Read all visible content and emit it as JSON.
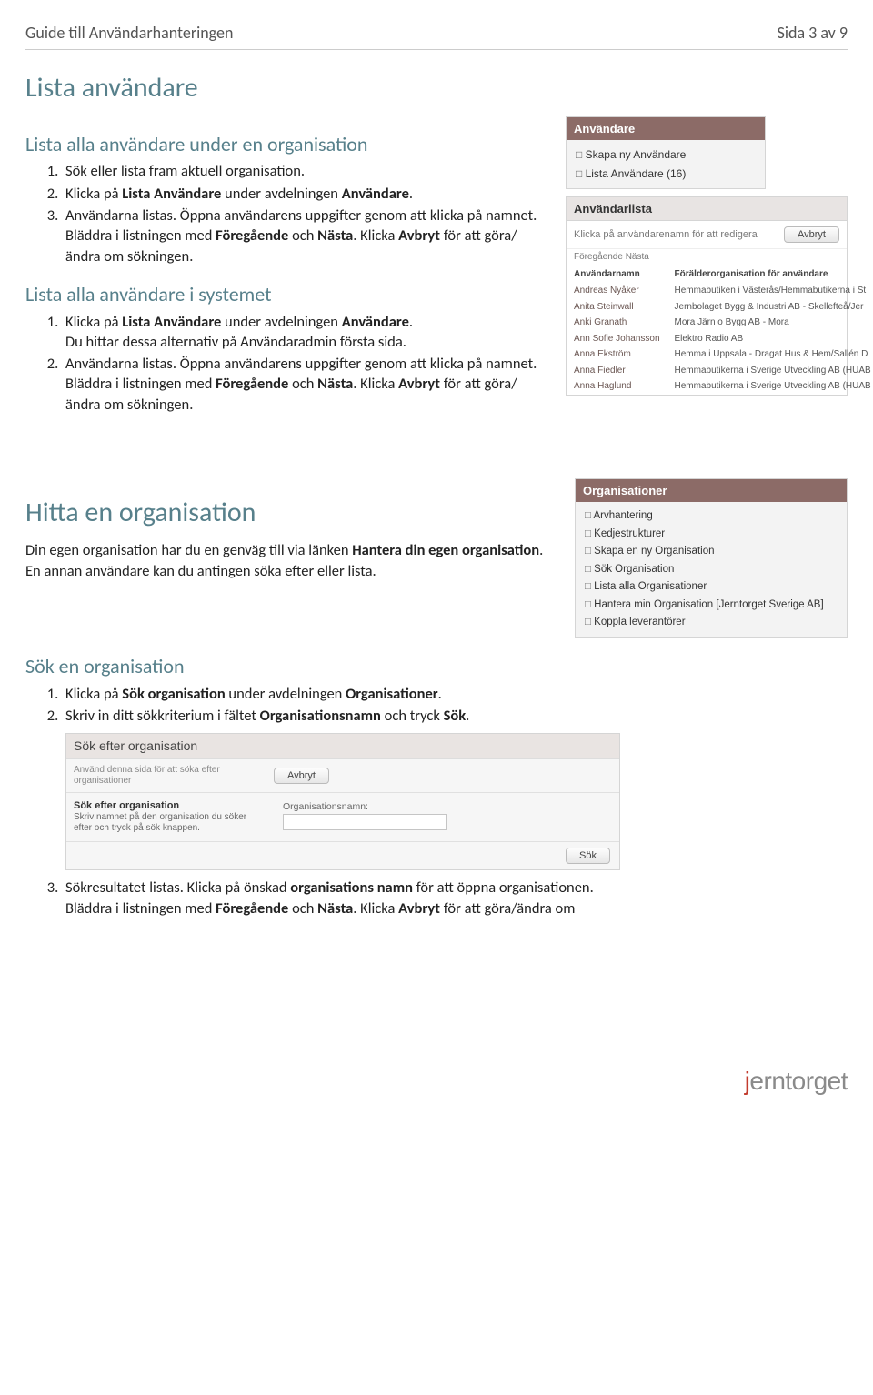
{
  "header": {
    "title": "Guide till Användarhanteringen",
    "page": "Sida 3 av 9"
  },
  "h1_list": "Lista användare",
  "h2_list_org": "Lista alla användare under en organisation",
  "list_org_steps": [
    "Sök eller lista fram aktuell organisation.",
    "Klicka på Lista Användare under avdelningen Användare.",
    "Användarna listas. Öppna användarens uppgifter genom att klicka på namnet."
  ],
  "list_org_after": "Bläddra i listningen med Föregående och Nästa. Klicka Avbryt för att göra/ändra om sökningen.",
  "h2_list_sys": "Lista alla användare i systemet",
  "list_sys_step1a": "Klicka på Lista Användare under avdelningen Användare.",
  "list_sys_step1b": "Du hittar dessa alternativ på Användaradmin första sida.",
  "list_sys_step2": "Användarna listas. Öppna användarens uppgifter genom att klicka på namnet.",
  "list_sys_after": "Bläddra i listningen med Föregående och Nästa. Klicka Avbryt för att göra/ändra om sökningen.",
  "anv_panel": {
    "title": "Användare",
    "items": [
      "Skapa ny Användare",
      "Lista Användare (16)"
    ]
  },
  "user_list_panel": {
    "title": "Användarlista",
    "hint": "Klicka på användarenamn för att redigera",
    "avbryt": "Avbryt",
    "crumbs": "Föregående Nästa",
    "col1": "Användarnamn",
    "col2": "Förälderorganisation för användare",
    "rows": [
      [
        "Andreas Nyåker",
        "Hemmabutiken i Västerås/Hemmabutikerna i St"
      ],
      [
        "Anita Steinwall",
        "Jernbolaget Bygg & Industri AB - Skellefteå/Jer"
      ],
      [
        "Anki Granath",
        "Mora Järn o Bygg AB - Mora"
      ],
      [
        "Ann Sofie Johansson",
        "Elektro Radio AB"
      ],
      [
        "Anna Ekström",
        "Hemma i Uppsala - Dragat Hus & Hem/Sallén D"
      ],
      [
        "Anna Fiedler",
        "Hemmabutikerna i Sverige Utveckling AB (HUAB"
      ],
      [
        "Anna Haglund",
        "Hemmabutikerna i Sverige Utveckling AB (HUAB"
      ]
    ]
  },
  "h1_org": "Hitta en organisation",
  "org_intro": "Din egen organisation har du en genväg till via länken Hantera din egen organisation. En annan användare kan du antingen söka efter eller lista.",
  "org_panel": {
    "title": "Organisationer",
    "items": [
      "Arvhantering",
      "Kedjestrukturer",
      "Skapa en ny Organisation",
      "Sök Organisation",
      "Lista alla Organisationer",
      "Hantera min Organisation [Jerntorget Sverige AB]",
      "Koppla leverantörer"
    ]
  },
  "h2_search_org": "Sök en organisation",
  "search_steps_1": "Klicka på Sök organisation under avdelningen Organisationer.",
  "search_steps_2": "Skriv in ditt sökkriterium i fältet Organisationsnamn och tryck Sök.",
  "search_panel": {
    "title": "Sök efter organisation",
    "hint1": "Använd denna sida för att söka efter organisationer",
    "avbryt": "Avbryt",
    "sub_title": "Sök efter organisation",
    "sub_hint": "Skriv namnet på den organisation du söker efter och tryck på sök knappen.",
    "field_label": "Organisationsnamn:",
    "sok": "Sök"
  },
  "search_step3a": "Sökresultatet listas. Klicka på önskad organisations namn för att öppna organisationen.",
  "search_step3b": "Bläddra i listningen med Föregående och Nästa. Klicka Avbryt för att göra/ändra om",
  "footer": {
    "j": "j",
    "rest": "erntorget"
  }
}
